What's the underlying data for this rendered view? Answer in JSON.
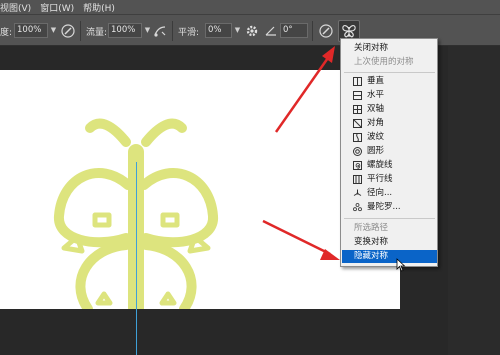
{
  "menubar": {
    "items": [
      "视图(V)",
      "窗口(W)",
      "帮助(H)"
    ]
  },
  "options": {
    "opacity_label": "度:",
    "opacity_value": "100%",
    "flow_label": "流量:",
    "flow_value": "100%",
    "smoothing_label": "平滑:",
    "smoothing_value": "0%",
    "angle_value": "0°",
    "icons": [
      "pressure-opacity-icon",
      "airbrush-icon",
      "settings-gear-icon",
      "angle-icon",
      "pressure-size-icon",
      "butterfly-symmetry-icon"
    ]
  },
  "symmetry_menu": {
    "top_items": [
      {
        "label": "关闭对称",
        "enabled": true
      },
      {
        "label": "上次使用的对称",
        "enabled": false
      }
    ],
    "options": [
      {
        "label": "垂直",
        "icon": "vertical-symmetry-icon"
      },
      {
        "label": "水平",
        "icon": "horizontal-symmetry-icon"
      },
      {
        "label": "双轴",
        "icon": "dual-axis-symmetry-icon"
      },
      {
        "label": "对角",
        "icon": "diagonal-symmetry-icon"
      },
      {
        "label": "波纹",
        "icon": "wavy-symmetry-icon"
      },
      {
        "label": "圆形",
        "icon": "circle-symmetry-icon"
      },
      {
        "label": "螺旋线",
        "icon": "spiral-symmetry-icon"
      },
      {
        "label": "平行线",
        "icon": "parallel-lines-symmetry-icon"
      },
      {
        "label": "径向...",
        "icon": "radial-symmetry-icon"
      },
      {
        "label": "曼陀罗...",
        "icon": "mandala-symmetry-icon"
      }
    ],
    "bottom_items": [
      {
        "label": "所选路径",
        "enabled": false
      },
      {
        "label": "变换对称",
        "enabled": true
      },
      {
        "label": "隐藏对称",
        "enabled": true,
        "highlighted": true
      }
    ]
  },
  "colors": {
    "ui_bg": "#535353",
    "workspace_bg": "#282828",
    "menu_bg": "#f0f0f0",
    "highlight": "#0a64c8",
    "arrow_red": "#e02828",
    "butterfly_stroke": "#dde47e",
    "symmetry_axis": "#3fa0d8"
  }
}
